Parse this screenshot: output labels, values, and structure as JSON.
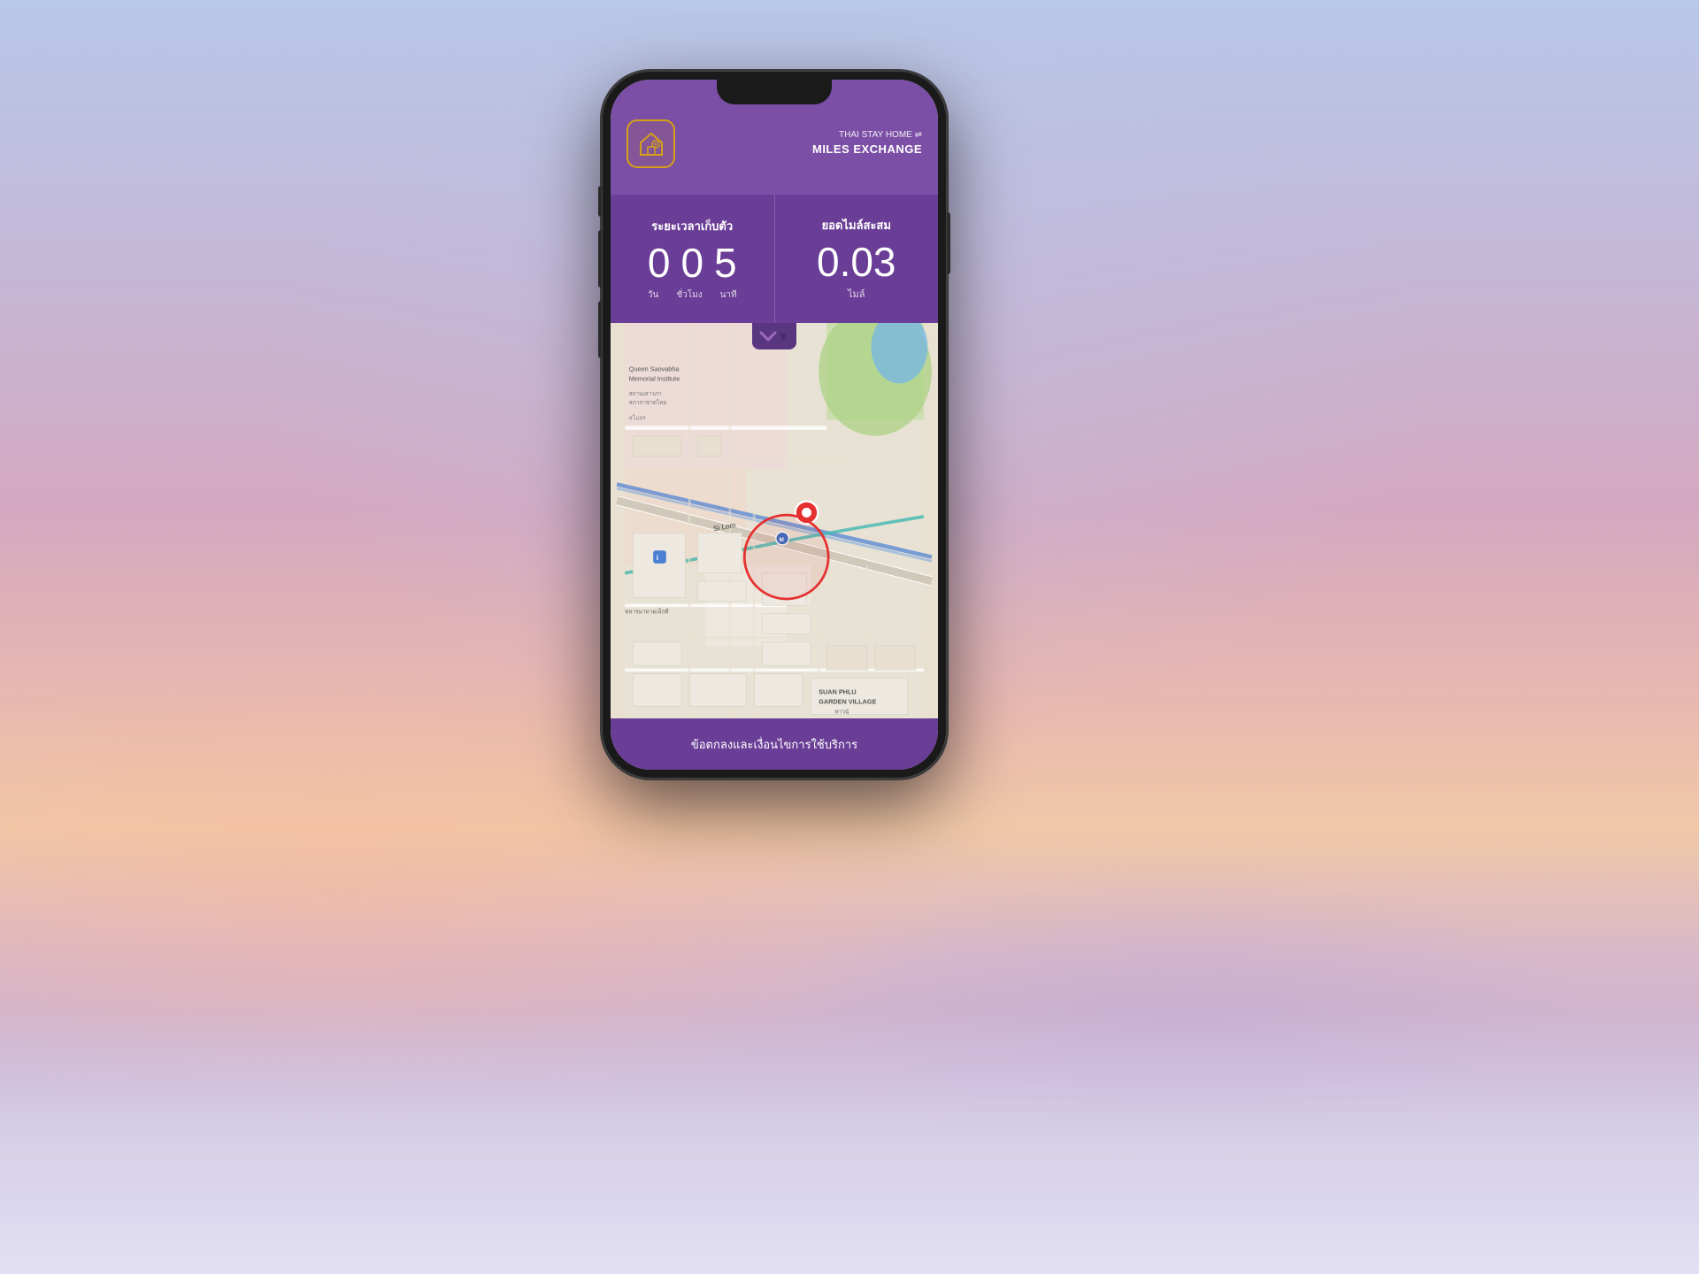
{
  "background": {
    "description": "Gradient sky background with pink and purple tones"
  },
  "phone": {
    "app": {
      "header": {
        "logo_symbol": "⌂",
        "title_line1": "THAI STAY HOME ⇌",
        "title_line2": "MILES EXCHANGE"
      },
      "stats": {
        "left_label": "ระยะเวลาเก็บตัว",
        "days_value": "0",
        "hours_value": "0",
        "minutes_value": "5",
        "days_unit": "วัน",
        "hours_unit": "ชั่วโมง",
        "minutes_unit": "นาที",
        "right_label": "ยอดไมล์สะสม",
        "miles_value": "0.03",
        "miles_unit": "ไมล์"
      },
      "map": {
        "location_name": "Si Lom",
        "nearby_place": "Queen Saovabha Memorial Institute",
        "district_label": "สถานเสาวภา สภากาชาดไทย",
        "area_label": "SUAN PHLU GARDEN VILLAGE",
        "metro_label": "M"
      },
      "bottom_bar": {
        "text": "ข้อตกลงและเงื่อนไขการใช้บริการ"
      }
    }
  }
}
